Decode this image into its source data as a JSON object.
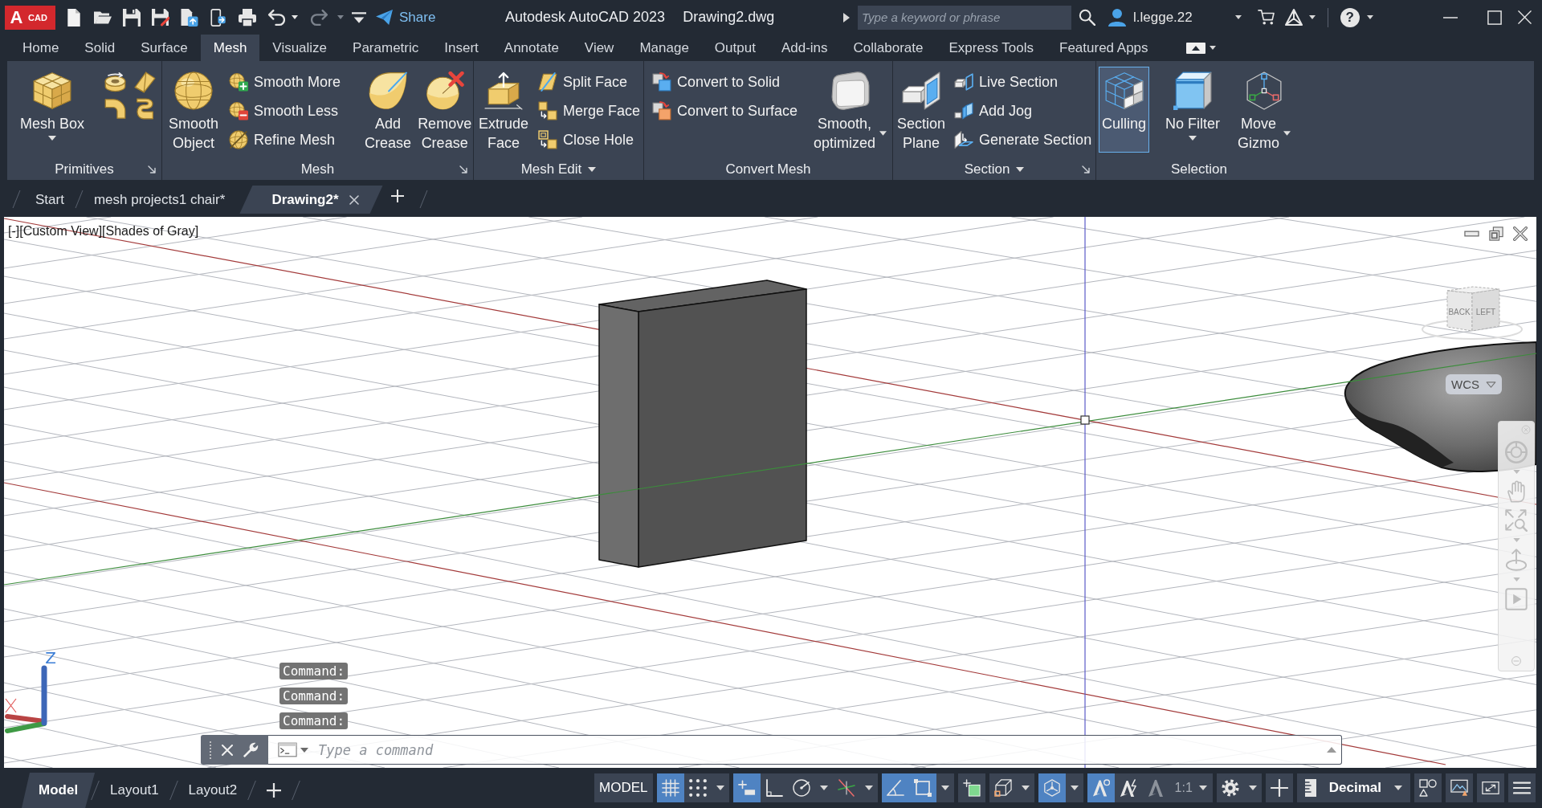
{
  "title_bar": {
    "logo": {
      "letter": "A",
      "badge": "CAD"
    },
    "share_label": "Share",
    "app_title": "Autodesk AutoCAD 2023",
    "document": "Drawing2.dwg",
    "search": {
      "placeholder": "Type a keyword or phrase"
    },
    "user": "l.legge.22",
    "help": "?"
  },
  "ribbon_tabs": [
    {
      "label": "Home",
      "selected": false
    },
    {
      "label": "Solid",
      "selected": false
    },
    {
      "label": "Surface",
      "selected": false
    },
    {
      "label": "Mesh",
      "selected": true
    },
    {
      "label": "Visualize",
      "selected": false
    },
    {
      "label": "Parametric",
      "selected": false
    },
    {
      "label": "Insert",
      "selected": false
    },
    {
      "label": "Annotate",
      "selected": false
    },
    {
      "label": "View",
      "selected": false
    },
    {
      "label": "Manage",
      "selected": false
    },
    {
      "label": "Output",
      "selected": false
    },
    {
      "label": "Add-ins",
      "selected": false
    },
    {
      "label": "Collaborate",
      "selected": false
    },
    {
      "label": "Express Tools",
      "selected": false
    },
    {
      "label": "Featured Apps",
      "selected": false
    }
  ],
  "ribbon_panels": [
    {
      "title": "Primitives",
      "launcher": true,
      "expandable": false,
      "items": [
        {
          "kind": "dropdown",
          "label": "Mesh Box",
          "on": false
        },
        {
          "kind": "icon_grid"
        }
      ]
    },
    {
      "title": "Mesh",
      "launcher": true,
      "expandable": false,
      "items": [
        {
          "kind": "button",
          "label": "Smooth\nObject",
          "on": false
        },
        {
          "kind": "stack",
          "buttons": [
            {
              "label": "Smooth More"
            },
            {
              "label": "Smooth Less"
            },
            {
              "label": "Refine Mesh"
            }
          ]
        },
        {
          "kind": "separator"
        },
        {
          "kind": "button",
          "label": "Add\nCrease",
          "on": false
        },
        {
          "kind": "button",
          "label": "Remove\nCrease",
          "on": false
        }
      ]
    },
    {
      "title": "Mesh Edit",
      "launcher": false,
      "expandable": true,
      "items": [
        {
          "kind": "button",
          "label": "Extrude\nFace",
          "on": false
        },
        {
          "kind": "stack",
          "buttons": [
            {
              "label": "Split Face"
            },
            {
              "label": "Merge Face"
            },
            {
              "label": "Close Hole"
            }
          ]
        }
      ]
    },
    {
      "title": "Convert Mesh",
      "launcher": false,
      "expandable": false,
      "items": [
        {
          "kind": "stack",
          "buttons": [
            {
              "label": "Convert to Solid"
            },
            {
              "label": "Convert to Surface"
            }
          ]
        },
        {
          "kind": "split",
          "label": "Smooth,\noptimized",
          "on": false
        }
      ]
    },
    {
      "title": "Section",
      "launcher": true,
      "expandable": true,
      "items": [
        {
          "kind": "button",
          "label": "Section\nPlane",
          "on": false
        },
        {
          "kind": "stack",
          "buttons": [
            {
              "label": "Live Section"
            },
            {
              "label": "Add Jog"
            },
            {
              "label": "Generate Section"
            }
          ]
        }
      ]
    },
    {
      "title": "Selection",
      "launcher": false,
      "expandable": false,
      "items": [
        {
          "kind": "button",
          "label": "Culling",
          "on": true
        },
        {
          "kind": "dropdown",
          "label": "No Filter",
          "on": false
        },
        {
          "kind": "split",
          "label": "Move\nGizmo",
          "on": false
        }
      ]
    }
  ],
  "file_tabs": [
    {
      "label": "Start",
      "selected": false
    },
    {
      "label": "mesh projects1 chair*",
      "selected": false
    },
    {
      "label": "Drawing2*",
      "selected": true
    }
  ],
  "viewport": {
    "controls": [
      "[-]",
      "[Custom View]",
      "[Shades of Gray]"
    ],
    "view_cube": {
      "faces": [
        "BACK",
        "LEFT"
      ]
    },
    "ucs_menu": "WCS",
    "ucs_axis_label": "Z"
  },
  "command_history": [
    "Command:",
    "Command:",
    "Command:"
  ],
  "command_line": {
    "placeholder": "Type a command"
  },
  "layout_tabs": [
    {
      "label": "Model",
      "selected": true
    },
    {
      "label": "Layout1",
      "selected": false
    },
    {
      "label": "Layout2",
      "selected": false
    }
  ],
  "status_groups": [
    [
      {
        "kind": "space",
        "label": "MODEL"
      }
    ],
    [
      {
        "kind": "grid",
        "on": true
      },
      {
        "kind": "snap",
        "on": false,
        "menu": true
      }
    ],
    [
      {
        "kind": "infer",
        "on": true
      },
      {
        "kind": "ortho",
        "on": false
      },
      {
        "kind": "polar",
        "on": false,
        "menu": true
      },
      {
        "kind": "isodraft",
        "on": false,
        "menu": true
      }
    ],
    [
      {
        "kind": "tracking",
        "on": true
      },
      {
        "kind": "osnap",
        "on": true,
        "menu": true
      }
    ],
    [
      {
        "kind": "transparency",
        "on": false
      }
    ],
    [
      {
        "kind": "osnap3d",
        "on": false,
        "menu": true
      }
    ],
    [
      {
        "kind": "gizmo",
        "on": true,
        "menu": true
      }
    ],
    [
      {
        "kind": "annotation_visibility",
        "on": true
      },
      {
        "kind": "autoscale",
        "on": false
      },
      {
        "kind": "annotation_scale",
        "on": false
      },
      {
        "kind": "scale",
        "label": "1:1",
        "menu": true
      }
    ],
    [
      {
        "kind": "workspace",
        "menu": true
      }
    ],
    [
      {
        "kind": "add"
      }
    ],
    [
      {
        "kind": "units",
        "label": "Decimal",
        "menu": true
      }
    ],
    [
      {
        "kind": "isolate",
        "on": false
      }
    ],
    [
      {
        "kind": "hardware"
      }
    ],
    [
      {
        "kind": "fullscreen",
        "on": false
      }
    ],
    [
      {
        "kind": "customize"
      }
    ]
  ]
}
